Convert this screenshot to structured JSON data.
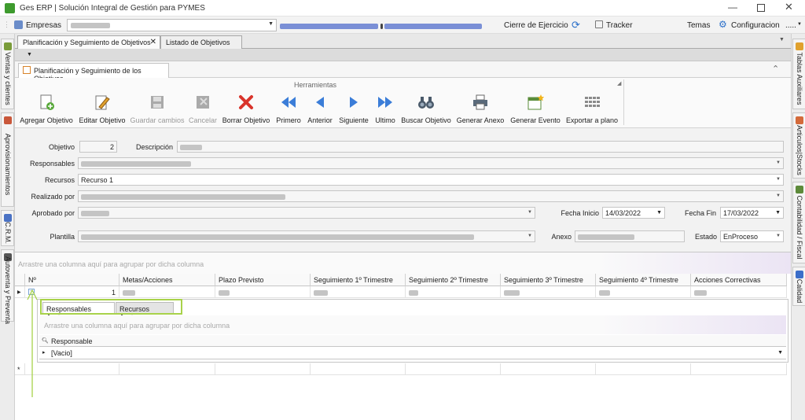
{
  "window": {
    "title": "Ges ERP | Solución Integral de Gestión para PYMES"
  },
  "menubar": {
    "empresas": "Empresas",
    "cierre": "Cierre de Ejercicio",
    "tracker": "Tracker",
    "temas": "Temas",
    "configuracion": "Configuracion",
    "more": "....."
  },
  "left_tabs": [
    "Ventas y clientes",
    "Aprovisionamientos",
    "C.R.M.",
    "Autoventa y Preventa"
  ],
  "right_tabs": [
    "Tablas Auxiliares",
    "Articulos|Stocks",
    "Contabilidad / Fiscal",
    "Calidad"
  ],
  "doc_tabs": [
    "Planificación y Seguimiento de Objetivos",
    "Listado de Objetivos"
  ],
  "panel": {
    "title": "Planificación y Seguimiento de los Objetivos"
  },
  "toolbar": {
    "group_title": "Herramientas",
    "buttons": [
      "Agregar Objetivo",
      "Editar Objetivo",
      "Guardar cambios",
      "Cancelar",
      "Borrar Objetivo",
      "Primero",
      "Anterior",
      "Siguiente",
      "Ultimo",
      "Buscar Objetivo",
      "Generar Anexo",
      "Generar Evento",
      "Exportar a plano"
    ]
  },
  "form": {
    "objetivo_label": "Objetivo",
    "objetivo_value": "2",
    "descripcion_label": "Descripción",
    "responsables_label": "Responsables",
    "recursos_label": "Recursos",
    "recursos_value": "Recurso 1",
    "realizado_label": "Realizado por",
    "aprobado_label": "Aprobado por",
    "fecha_inicio_label": "Fecha Inicio",
    "fecha_inicio_value": "14/03/2022",
    "fecha_fin_label": "Fecha Fin",
    "fecha_fin_value": "17/03/2022",
    "plantilla_label": "Plantilla",
    "anexo_label": "Anexo",
    "estado_label": "Estado",
    "estado_value": "EnProceso"
  },
  "grid": {
    "group_hint": "Arrastre una columna aquí para agrupar por dicha columna",
    "columns": [
      "Nº",
      "Metas/Acciones",
      "Plazo Previsto",
      "Seguimiento 1º Trimestre",
      "Seguimiento 2º Trimestre",
      "Seguimiento 3º Trimestre",
      "Seguimiento 4º Trimestre",
      "Acciones Correctivas"
    ],
    "row_number": "1",
    "detail_tabs": [
      "Responsables Accion",
      "Recursos Accion"
    ],
    "detail_group_hint": "Arrastre una columna aquí para agrupar por dicha columna",
    "detail_column": "Responsable",
    "detail_value": "[Vacio]",
    "new_row_marker": "*"
  },
  "colors": {
    "accent": "#a8d24a",
    "delete": "#d9342b",
    "nav": "#3b7dd8"
  }
}
